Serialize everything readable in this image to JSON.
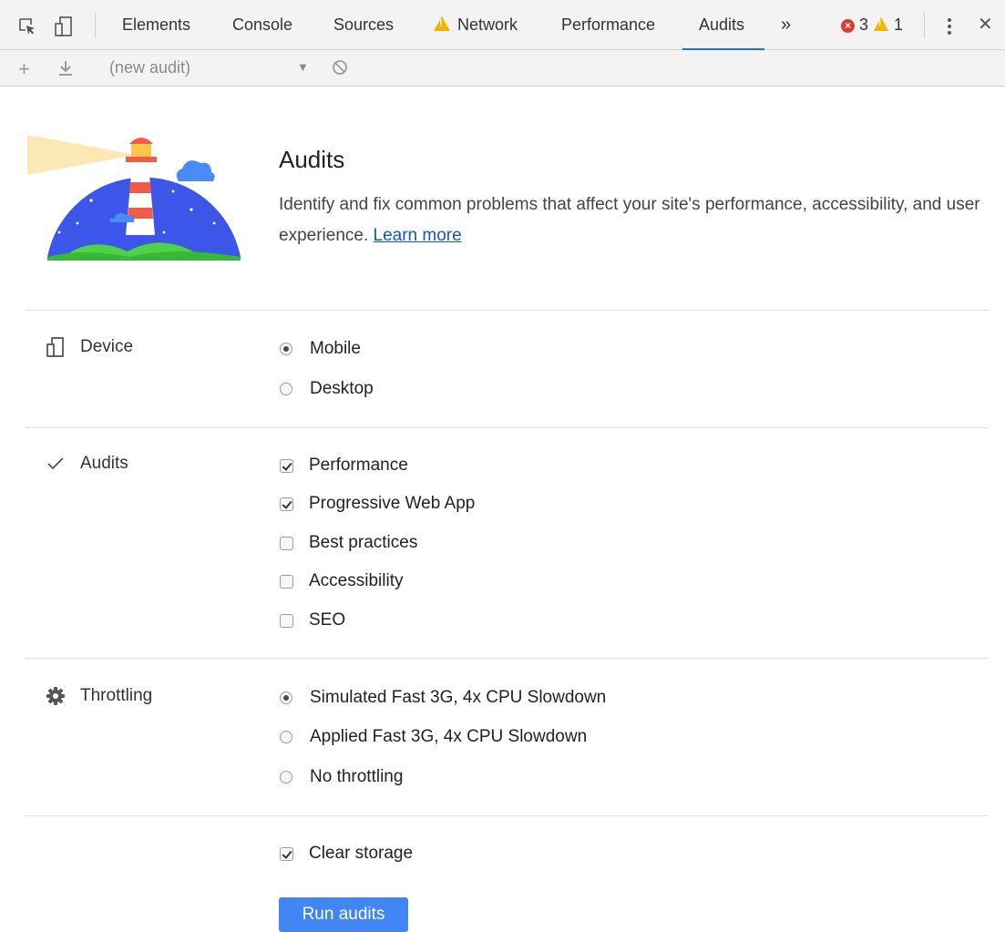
{
  "tabs": [
    {
      "label": "Elements"
    },
    {
      "label": "Console"
    },
    {
      "label": "Sources"
    },
    {
      "label": "Network",
      "warning": true
    },
    {
      "label": "Performance"
    },
    {
      "label": "Audits",
      "active": true
    }
  ],
  "overflow_label": "»",
  "errors": {
    "count": "3",
    "warnings": "1"
  },
  "close_label": "✕",
  "audit_select": {
    "value": "(new audit)"
  },
  "header": {
    "title": "Audits",
    "description": "Identify and fix common problems that affect your site's performance, accessibility, and user experience.",
    "learn_more": "Learn more"
  },
  "device": {
    "label": "Device",
    "options": [
      {
        "label": "Mobile",
        "selected": true
      },
      {
        "label": "Desktop",
        "selected": false
      }
    ]
  },
  "audits": {
    "label": "Audits",
    "options": [
      {
        "label": "Performance",
        "checked": true
      },
      {
        "label": "Progressive Web App",
        "checked": true
      },
      {
        "label": "Best practices",
        "checked": false
      },
      {
        "label": "Accessibility",
        "checked": false
      },
      {
        "label": "SEO",
        "checked": false
      }
    ]
  },
  "throttling": {
    "label": "Throttling",
    "options": [
      {
        "label": "Simulated Fast 3G, 4x CPU Slowdown",
        "selected": true
      },
      {
        "label": "Applied Fast 3G, 4x CPU Slowdown",
        "selected": false
      },
      {
        "label": "No throttling",
        "selected": false
      }
    ]
  },
  "clear_storage": {
    "label": "Clear storage",
    "checked": true
  },
  "run_button": "Run audits",
  "colors": {
    "accent": "#4285f4",
    "tab_underline": "#1a73e8",
    "error": "#e53935",
    "warning": "#f5b400"
  }
}
